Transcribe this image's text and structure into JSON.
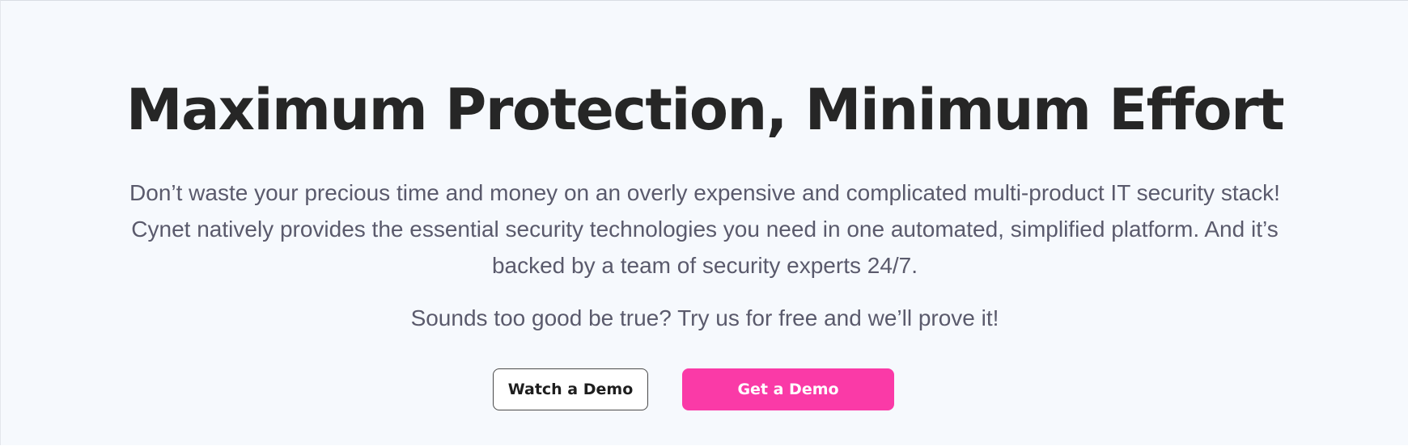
{
  "hero": {
    "headline": "Maximum Protection, Minimum Effort",
    "description": "Don’t waste your precious time and money on an overly expensive and complicated multi-product IT security stack!  Cynet natively provides the essential security technologies you need in one automated, simplified platform. And it’s backed by a team of security experts 24/7.",
    "tagline": "Sounds too good be true?  Try us for free and we’ll prove it!",
    "buttons": {
      "watch_demo_label": "Watch a Demo",
      "get_demo_label": "Get a Demo"
    }
  },
  "colors": {
    "background": "#f6f9fd",
    "headline_text": "#262626",
    "body_text": "#5a5a6c",
    "primary_button": "#fa3aa7",
    "outline_button_border": "#4a4a4a"
  }
}
